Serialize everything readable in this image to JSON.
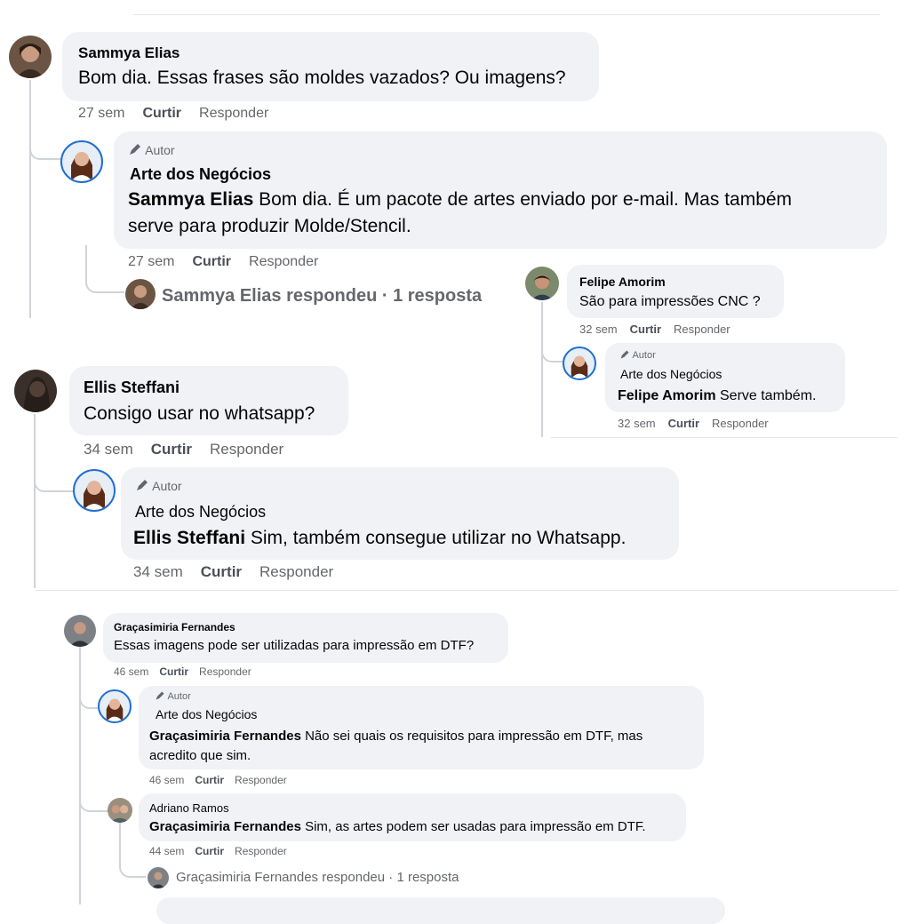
{
  "c1": {
    "author": "Sammya Elias",
    "text": "Bom dia. Essas frases são moldes vazados? Ou imagens?",
    "time": "27 sem",
    "like": "Curtir",
    "reply": "Responder",
    "reply1": {
      "badge": "Autor",
      "author": "Arte dos Negócios",
      "mention": "Sammya Elias",
      "line1": " Bom dia. É um pacote de artes enviado por e-mail. Mas também",
      "line2": "serve para produzir Molde/Stencil.",
      "time": "27 sem",
      "like": "Curtir",
      "reply": "Responder"
    },
    "more_replies": "Sammya Elias respondeu · 1 resposta"
  },
  "c2": {
    "author": "Felipe Amorim",
    "text": "São para impressões CNC ?",
    "time": "32 sem",
    "like": "Curtir",
    "reply": "Responder",
    "reply1": {
      "badge": "Autor",
      "author": "Arte dos Negócios",
      "mention": "Felipe Amorim",
      "text": " Serve também.",
      "time": "32 sem",
      "like": "Curtir",
      "reply": "Responder"
    }
  },
  "c3": {
    "author": "Ellis Steffani",
    "text": "Consigo usar no whatsapp?",
    "time": "34 sem",
    "like": "Curtir",
    "reply": "Responder",
    "reply1": {
      "badge": "Autor",
      "author": "Arte dos Negócios",
      "mention": "Ellis Steffani",
      "text": " Sim, também consegue utilizar no Whatsapp.",
      "time": "34 sem",
      "like": "Curtir",
      "reply": "Responder"
    }
  },
  "c4": {
    "author": "Graçasimiria Fernandes",
    "text": "Essas imagens pode ser utilizadas para impressão em DTF?",
    "time": "46 sem",
    "like": "Curtir",
    "reply": "Responder",
    "reply1": {
      "badge": "Autor",
      "author": "Arte dos Negócios",
      "mention": "Graçasimiria Fernandes",
      "line1": " Não sei quais os requisitos para impressão em DTF, mas",
      "line2": "acredito que sim.",
      "time": "46 sem",
      "like": "Curtir",
      "reply": "Responder"
    },
    "reply2": {
      "author": "Adriano Ramos",
      "mention": "Graçasimiria Fernandes",
      "text": " Sim, as artes podem ser usadas para impressão em DTF.",
      "time": "44 sem",
      "like": "Curtir",
      "reply": "Responder"
    },
    "more_replies": "Graçasimiria Fernandes respondeu · 1 resposta"
  },
  "icons": {
    "pencil": "pencil-icon"
  }
}
